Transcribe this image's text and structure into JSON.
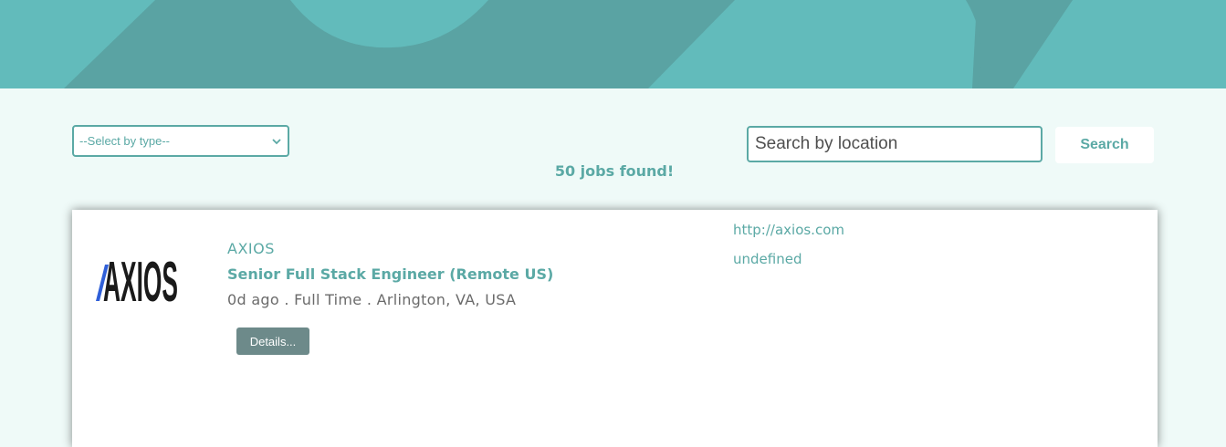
{
  "filters": {
    "type_select_value": "--Select by type--",
    "location_placeholder": "Search by location",
    "search_label": "Search"
  },
  "results": {
    "count_text": "50 jobs found!"
  },
  "jobs": [
    {
      "company": "AXIOS",
      "logo_text": "AXIOS",
      "title": "Senior Full Stack Engineer (Remote US)",
      "meta": "0d ago . Full Time . Arlington, VA, USA",
      "details_label": "Details...",
      "url": "http://axios.com",
      "extra": "undefined"
    }
  ],
  "colors": {
    "accent": "#5ba9a5",
    "hero_light": "#62bbbb",
    "hero_dark": "#5aa3a3",
    "page_bg": "#effaf8",
    "details_button": "#6d8a8a"
  }
}
